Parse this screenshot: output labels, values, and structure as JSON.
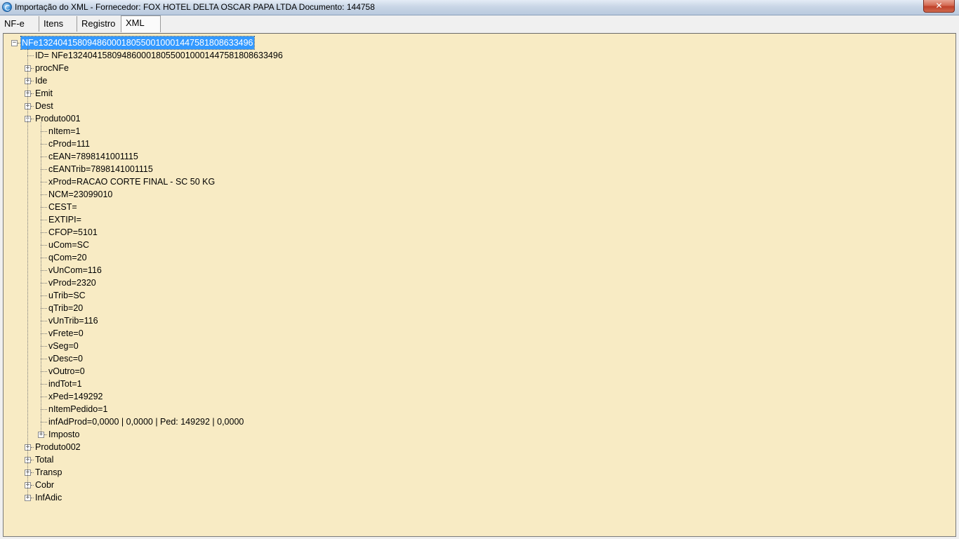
{
  "window": {
    "title": "Importação do XML - Fornecedor: FOX HOTEL DELTA OSCAR PAPA LTDA Documento: 144758",
    "close_label": "✕",
    "icon": "app-icon"
  },
  "tabs": [
    {
      "label": "NF-e",
      "active": false
    },
    {
      "label": "Itens",
      "active": false
    },
    {
      "label": "Registro",
      "active": false
    },
    {
      "label": "XML",
      "active": true
    }
  ],
  "tree": {
    "background": "#f8ebc4",
    "selection_color": "#3399ff",
    "root": {
      "label": "NFe13240415809486000180550010001447581808633496",
      "expanded": true,
      "selected": true,
      "children": [
        {
          "label": "ID= NFe13240415809486000180550010001447581808633496",
          "leaf": true
        },
        {
          "label": "procNFe",
          "expandable": true,
          "expanded": false
        },
        {
          "label": "Ide",
          "expandable": true,
          "expanded": false
        },
        {
          "label": "Emit",
          "expandable": true,
          "expanded": false
        },
        {
          "label": "Dest",
          "expandable": true,
          "expanded": false
        },
        {
          "label": "Produto001",
          "expandable": true,
          "expanded": true,
          "children": [
            {
              "label": "nItem=1",
              "leaf": true
            },
            {
              "label": "cProd=111",
              "leaf": true
            },
            {
              "label": "cEAN=7898141001115",
              "leaf": true
            },
            {
              "label": "cEANTrib=7898141001115",
              "leaf": true
            },
            {
              "label": "xProd=RACAO CORTE FINAL - SC 50 KG",
              "leaf": true
            },
            {
              "label": "NCM=23099010",
              "leaf": true
            },
            {
              "label": "CEST=",
              "leaf": true
            },
            {
              "label": "EXTIPI=",
              "leaf": true
            },
            {
              "label": "CFOP=5101",
              "leaf": true
            },
            {
              "label": "uCom=SC",
              "leaf": true
            },
            {
              "label": "qCom=20",
              "leaf": true
            },
            {
              "label": "vUnCom=116",
              "leaf": true
            },
            {
              "label": "vProd=2320",
              "leaf": true
            },
            {
              "label": "uTrib=SC",
              "leaf": true
            },
            {
              "label": "qTrib=20",
              "leaf": true
            },
            {
              "label": "vUnTrib=116",
              "leaf": true
            },
            {
              "label": "vFrete=0",
              "leaf": true
            },
            {
              "label": "vSeg=0",
              "leaf": true
            },
            {
              "label": "vDesc=0",
              "leaf": true
            },
            {
              "label": "vOutro=0",
              "leaf": true
            },
            {
              "label": "indTot=1",
              "leaf": true
            },
            {
              "label": "xPed=149292",
              "leaf": true
            },
            {
              "label": "nItemPedido=1",
              "leaf": true
            },
            {
              "label": "infAdProd=0,0000 | 0,0000 | Ped: 149292 | 0,0000",
              "leaf": true
            },
            {
              "label": "Imposto",
              "expandable": true,
              "expanded": false
            }
          ]
        },
        {
          "label": "Produto002",
          "expandable": true,
          "expanded": false
        },
        {
          "label": "Total",
          "expandable": true,
          "expanded": false
        },
        {
          "label": "Transp",
          "expandable": true,
          "expanded": false
        },
        {
          "label": "Cobr",
          "expandable": true,
          "expanded": false
        },
        {
          "label": "InfAdic",
          "expandable": true,
          "expanded": false
        }
      ]
    }
  }
}
